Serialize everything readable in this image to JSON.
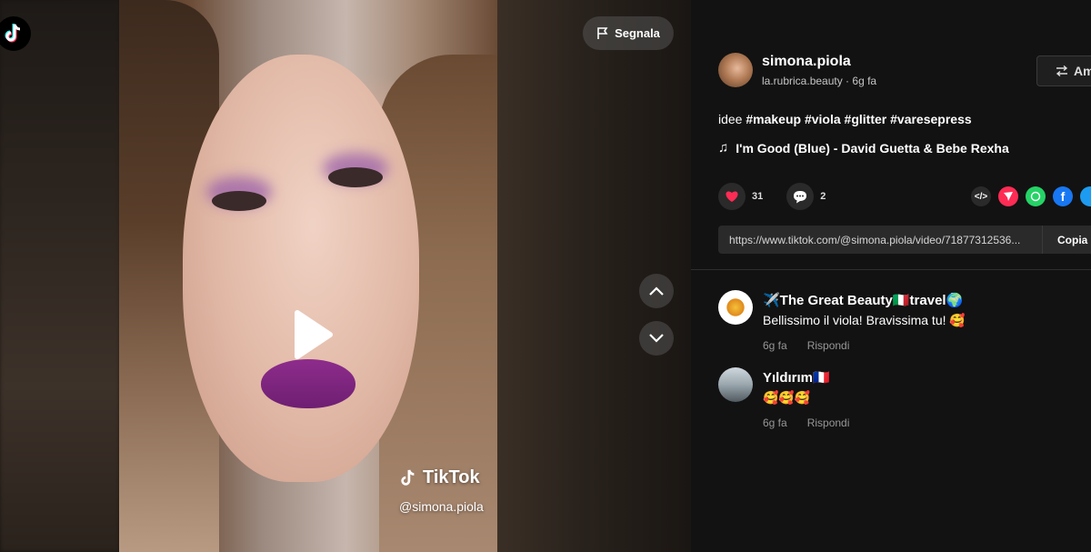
{
  "report": {
    "label": "Segnala"
  },
  "video": {
    "watermark_brand": "TikTok",
    "watermark_handle": "@simona.piola"
  },
  "author": {
    "username": "simona.piola",
    "nickname": "la.rubrica.beauty",
    "separator": " · ",
    "age": "6g fa"
  },
  "follow": {
    "label": "Am"
  },
  "description": {
    "text": "idee",
    "hashtags": [
      "#makeup",
      "#viola",
      "#glitter",
      "#varesepress"
    ]
  },
  "music": {
    "title": "I'm Good (Blue) - David Guetta & Bebe Rexha"
  },
  "stats": {
    "likes": "31",
    "comments": "2"
  },
  "share": {
    "link": "https://www.tiktok.com/@simona.piola/video/71877312536...",
    "copy_label": "Copia"
  },
  "comments": [
    {
      "author": "✈️The Great Beauty🇮🇹travel🌍",
      "text": "Bellissimo il viola! Bravissima tu! 🥰",
      "age": "6g fa",
      "reply": "Rispondi"
    },
    {
      "author": "Yıldırım🇫🇷",
      "text": "🥰🥰🥰",
      "age": "6g fa",
      "reply": "Rispondi"
    }
  ],
  "colors": {
    "background": "#121212",
    "like_red": "#fe2c55",
    "whatsapp": "#25d366",
    "facebook": "#1877f2"
  }
}
